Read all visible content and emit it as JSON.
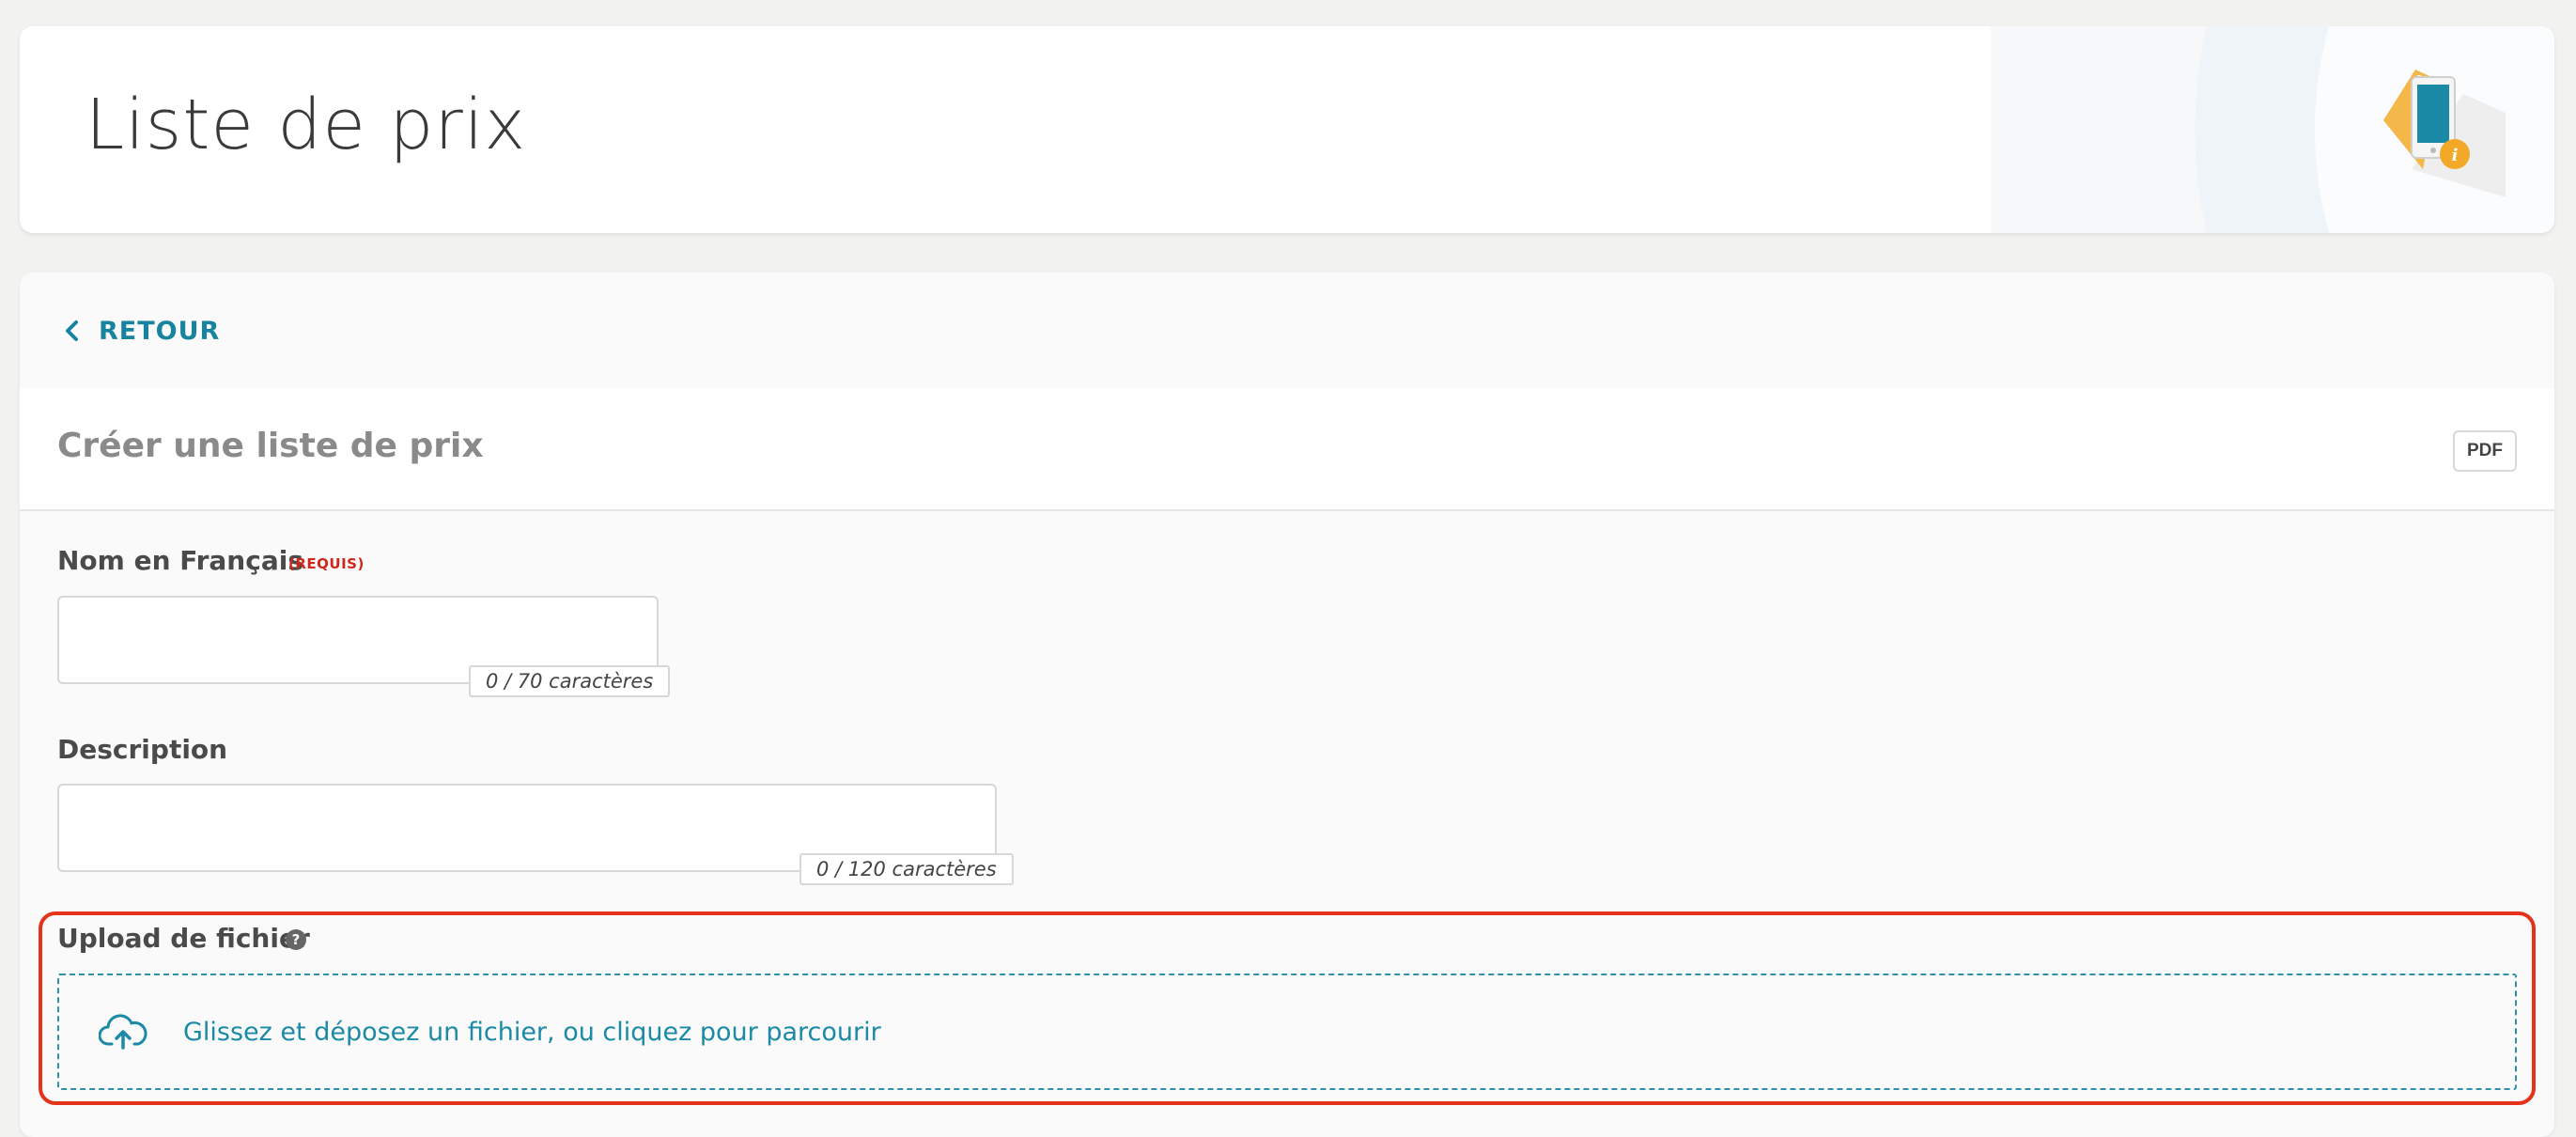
{
  "header": {
    "title": "Liste de prix",
    "illustration_icon": "price-tag-phone-info-icon"
  },
  "navigation": {
    "back_label": "RETOUR",
    "back_icon": "chevron-left-icon"
  },
  "form": {
    "title": "Créer une liste de prix",
    "pdf_label": "PDF",
    "fields": {
      "name": {
        "label": "Nom en Français",
        "required_tag": "(REQUIS)",
        "value": "",
        "counter": "0 / 70 caractères"
      },
      "description": {
        "label": "Description",
        "value": "",
        "counter": "0 / 120 caractères"
      },
      "upload": {
        "label": "Upload de fichier",
        "help_icon": "question-circle-icon",
        "help_glyph": "?",
        "dropzone_icon": "cloud-upload-icon",
        "dropzone_text": "Glissez et déposez un fichier, ou cliquez pour parcourir"
      }
    }
  },
  "colors": {
    "accent": "#17839e",
    "required": "#d0271d",
    "highlight": "#e4321b",
    "background": "#f2f2f1"
  }
}
